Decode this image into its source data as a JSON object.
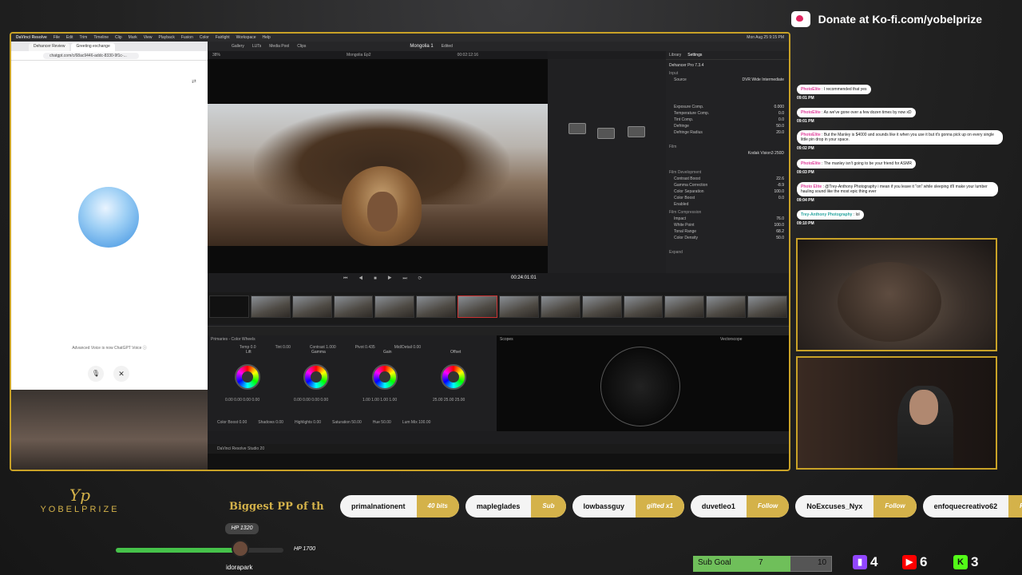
{
  "overlay": {
    "donate": "Donate at Ko-fi.com/yobelprize",
    "logo_mark": "Yp",
    "logo_name": "YOBELPRIZE",
    "ticker": "Biggest PP of th",
    "hp_current": "HP 1320",
    "hp_max": "HP 1700",
    "hp_fraction": 0.78,
    "avatar_name": "idorapark",
    "sub_goal": {
      "label": "Sub Goal",
      "current": "7",
      "target": "10",
      "fraction": 0.7
    },
    "platforms": [
      {
        "icon": "twitch-icon",
        "count": "4",
        "color": "#9146ff"
      },
      {
        "icon": "youtube-icon",
        "count": "6",
        "color": "#ff0000"
      },
      {
        "icon": "kick-icon",
        "count": "3",
        "color": "#53fc18"
      }
    ],
    "events": [
      {
        "name": "primalnationent",
        "tag": "40 bits"
      },
      {
        "name": "mapleglades",
        "tag": "Sub"
      },
      {
        "name": "lowbassguy",
        "tag": "gifted x1"
      },
      {
        "name": "duvetleo1",
        "tag": "Follow"
      },
      {
        "name": "NoExcuses_Nyx",
        "tag": "Follow"
      },
      {
        "name": "enfoquecreativo62",
        "tag": "Follo"
      }
    ]
  },
  "chat": [
    {
      "user": "PhotoElite",
      "text": "I recommended that yes",
      "time": "09:01 PM"
    },
    {
      "user": "PhotoElite",
      "text": "As we've gone over a few dozen times by now xD",
      "time": "09:01 PM"
    },
    {
      "user": "PhotoElite",
      "text": "But the Manley is $4000 and sounds like it when you use it but it's gonna pick up on every single little pin drop in your space.",
      "time": "09:02 PM"
    },
    {
      "user": "PhotoElite",
      "text": "The manley isn't going to be your friend for ASMR",
      "time": "09:03 PM"
    },
    {
      "user": "Photo Elite",
      "text": "@Trey-Anthony Photography i mean if you leave it \"on\" while sleeping it'll make your lumber hauling sound like the most epic thing ever",
      "time": "09:04 PM"
    },
    {
      "user": "Trey-Anthony Photography",
      "text": "lol",
      "time": "09:10 PM"
    }
  ],
  "mac_menu": [
    "DaVinci Resolve",
    "File",
    "Edit",
    "Trim",
    "Timeline",
    "Clip",
    "Mark",
    "View",
    "Playback",
    "Fusion",
    "Color",
    "Fairlight",
    "Workspace",
    "Help"
  ],
  "mac_clock": "Mon Aug 25  9:15 PM",
  "browser": {
    "tabs": [
      "Dehancer Review",
      "Greeting exchange"
    ],
    "url": "chatgpt.com/c/68ac9446-addc-8330-9f1c-...",
    "voice_note": "Advanced Voice is now ChatGPT Voice ⓘ",
    "mic": "🎙",
    "close": "✕"
  },
  "resolve": {
    "top_items": [
      "Gallery",
      "LUTs",
      "Media Pool",
      "Clips"
    ],
    "project": "Mongolia 1",
    "edited": "Edited",
    "zoom": "38%",
    "clip_name": "Mongolia Ep2",
    "viewer_tc": "00:02:12:16",
    "timecode": "00:24:01:01",
    "transport": "⏮ ◀ ■ ▶ ⏭ ⟳",
    "inspector_tabs": [
      "Library",
      "Settings"
    ],
    "plugin": "Dehancer Pro 7.3.4",
    "input_head": "Input",
    "source_label": "Source",
    "source_val": "DVR Wide Intermediate",
    "rows1": [
      {
        "k": "Exposure Comp.",
        "v": "0.000"
      },
      {
        "k": "Temperature Comp.",
        "v": "0.0"
      },
      {
        "k": "Tint Comp.",
        "v": "0.0"
      },
      {
        "k": "Defringe",
        "v": "50.0"
      },
      {
        "k": "Defringe Radius",
        "v": "20.0"
      }
    ],
    "film_head": "Film",
    "profile_val": "Kodak Vision3 250D",
    "film_dev_head": "Film Development",
    "rows2": [
      {
        "k": "Contrast Boost",
        "v": "22.6"
      },
      {
        "k": "Gamma Correction",
        "v": "-8.9"
      },
      {
        "k": "Color Separation",
        "v": "100.0"
      },
      {
        "k": "Color Boost",
        "v": "0.0"
      }
    ],
    "film_comp_head": "Film Compression",
    "rows3": [
      {
        "k": "Impact",
        "v": "76.0"
      },
      {
        "k": "White Point",
        "v": "100.0"
      },
      {
        "k": "Tonal Range",
        "v": "68.2"
      },
      {
        "k": "Color Density",
        "v": "50.0"
      }
    ],
    "enabled": "Enabled",
    "expand_head": "Expand",
    "wheels_title": "Primaries - Color Wheels",
    "scopes_title": "Scopes",
    "vectorscope": "Vectorscope",
    "wheel_labels": [
      "Lift",
      "Gamma",
      "Gain",
      "Offset"
    ],
    "wheel_values": [
      "0.00  0.00  0.00  0.00",
      "0.00  0.00  0.00  0.00",
      "1.00  1.00  1.00  1.00",
      "25.00  25.00  25.00"
    ],
    "adjust": [
      "Temp 0.0",
      "Tint 0.00",
      "Contrast 1.000",
      "Pivot 0.435",
      "Mid/Detail 0.00"
    ],
    "bottom_adjust": [
      "Color Boost 0.00",
      "Shadows 0.00",
      "Highlights 0.00",
      "Saturation 50.00",
      "Hue 50.00",
      "Lum Mix 100.00"
    ],
    "footer": "DaVinci Resolve Studio 20"
  }
}
